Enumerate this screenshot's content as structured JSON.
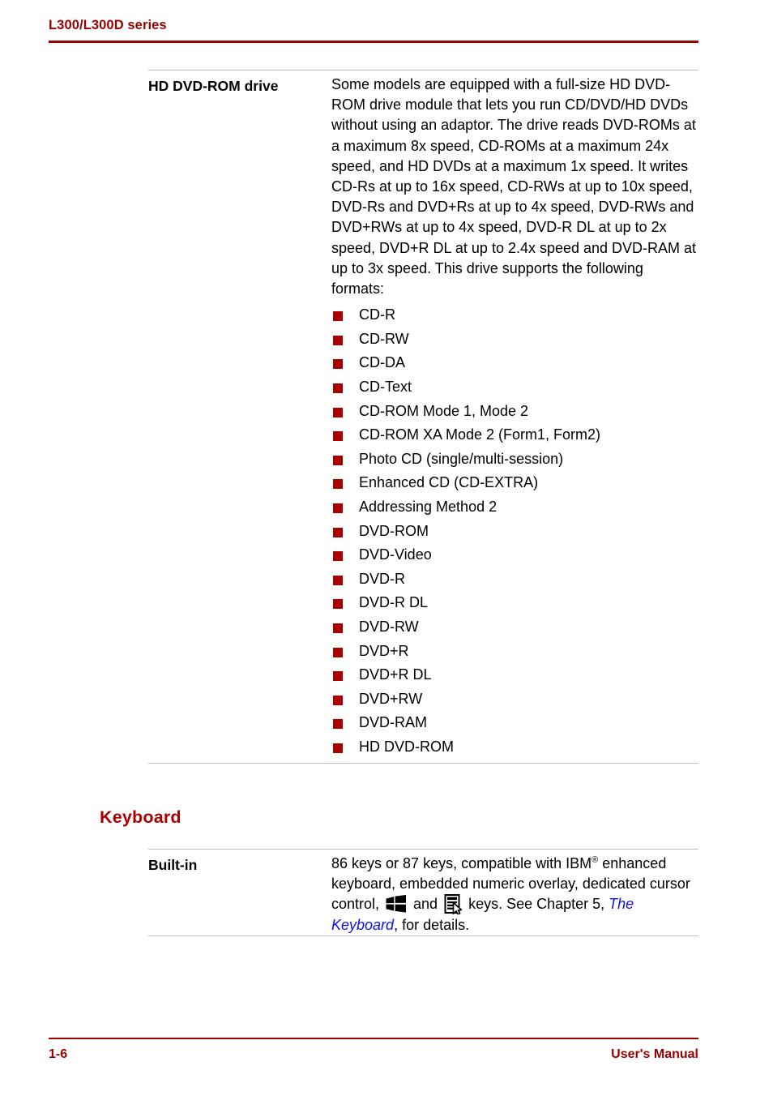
{
  "header": {
    "title": "L300/L300D series",
    "rule_color": "#990000"
  },
  "specs": [
    {
      "term": "HD DVD-ROM drive",
      "paragraph": "Some models are equipped with a full-size HD DVD-ROM drive module that lets you run CD/DVD/HD DVDs without using an adaptor. The drive reads DVD-ROMs at a maximum 8x speed, CD-ROMs at a maximum 24x speed, and HD DVDs at a maximum 1x speed. It writes CD-Rs at up to 16x speed, CD-RWs at up to 10x speed, DVD-Rs and DVD+Rs at up to 4x speed, DVD-RWs and DVD+RWs at up to 4x speed, DVD-R DL at up to 2x speed, DVD+R DL at up to 2.4x speed and DVD-RAM at up to 3x speed. This drive supports the following formats:",
      "formats": [
        "CD-R",
        "CD-RW",
        "CD-DA",
        "CD-Text",
        "CD-ROM Mode 1, Mode 2",
        "CD-ROM XA Mode 2 (Form1, Form2)",
        "Photo CD (single/multi-session)",
        "Enhanced CD (CD-EXTRA)",
        "Addressing Method 2",
        "DVD-ROM",
        "DVD-Video",
        "DVD-R",
        "DVD-R DL",
        "DVD-RW",
        "DVD+R",
        "DVD+R DL",
        "DVD+RW",
        "DVD-RAM",
        "HD DVD-ROM"
      ]
    }
  ],
  "section": {
    "heading": "Keyboard",
    "row": {
      "term": "Built-in",
      "text_part_1": "86 keys or 87 keys, compatible with IBM",
      "registered_mark": "®",
      "text_part_2": " enhanced keyboard, embedded numeric overlay, dedicated cursor control, ",
      "text_part_3": " and ",
      "text_part_4": " keys. See Chapter 5, ",
      "link_text": "The Keyboard",
      "text_part_5": ", for details."
    }
  },
  "icons": {
    "windows_key": "windows-logo-key-icon",
    "application_key": "application-menu-key-icon"
  },
  "footer": {
    "page_number": "1-6",
    "manual_label": "User's Manual"
  },
  "colors": {
    "brand_red": "#990000",
    "bullet_red": "#aa0000",
    "link_blue": "#1111ee",
    "separator_gray": "#c0c0c0"
  }
}
